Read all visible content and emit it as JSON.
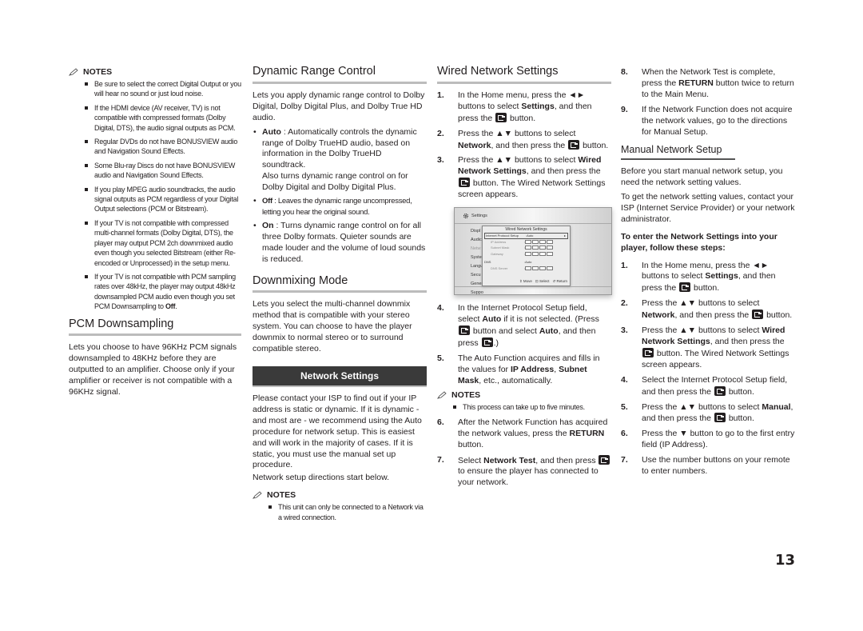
{
  "page_number": "13",
  "col1": {
    "notes_label": "NOTES",
    "notes": [
      "Be sure to select the correct Digital Output or you will hear no sound or just loud noise.",
      "If the HDMI device (AV receiver, TV) is not compatible with compressed formats (Dolby Digital, DTS), the audio signal outputs as PCM.",
      "Regular DVDs do not have BONUSVIEW audio and Navigation Sound Effects.",
      "Some Blu-ray Discs do not have BONUSVIEW audio and Navigation Sound Effects.",
      "If you play MPEG audio soundtracks, the audio signal outputs as PCM regardless of your Digital Output selections (PCM or Bitstream).",
      "If your TV is not compatible with compressed multi-channel formats (Dolby Digital, DTS), the player may output PCM 2ch downmixed audio even though you selected Bitstream (either Re-encoded or Unprocessed) in the setup menu."
    ],
    "note_last_prefix": "If your TV is not compatible with PCM sampling rates over 48kHz, the player may output 48kHz downsampled PCM audio even though you set PCM Downsampling to ",
    "note_last_bold": "Off",
    "note_last_suffix": ".",
    "pcm_title": "PCM Downsampling",
    "pcm_body": "Lets you choose to have 96KHz PCM signals downsampled to 48KHz before they are outputted to an amplifier. Choose only if your amplifier or receiver is not compatible with a 96KHz signal."
  },
  "col2": {
    "drc_title": "Dynamic Range Control",
    "drc_body": "Lets you apply dynamic range control to Dolby Digital, Dolby Digital Plus, and Dolby True HD audio.",
    "drc_options": [
      {
        "label": "Auto",
        "text": " : Automatically controls the dynamic range of Dolby TrueHD audio, based on information in the Dolby TrueHD soundtrack.",
        "extra": "Also turns dynamic range control on for Dolby Digital and Dolby Digital Plus."
      },
      {
        "label": "Off",
        "text": " : Leaves the dynamic range uncompressed, letting you hear the original sound."
      },
      {
        "label": "On",
        "text": " : Turns dynamic range control on for all three Dolby formats. Quieter sounds are made louder and the volume of loud sounds is reduced."
      }
    ],
    "downmix_title": "Downmixing Mode",
    "downmix_body": "Lets you select the multi-channel downmix method that is compatible with your stereo system. You can choose to have the player downmix to normal stereo or to surround compatible stereo.",
    "banner": "Network Settings",
    "network_body": "Please contact your ISP to find out if your IP address is static or dynamic. If it is dynamic - and most are - we recommend using the Auto procedure for network setup. This is easiest and will work in the majority of cases. If it is static, you must use the manual set up procedure.",
    "network_body2": "Network setup directions start below.",
    "notes_label": "NOTES",
    "notes": [
      "This unit can only be connected to a Network via a wired connection."
    ]
  },
  "col3": {
    "title": "Wired Network Settings",
    "steps": {
      "s1": {
        "num": "1.",
        "a": "In the Home menu, press the ◄► buttons to select ",
        "b": "Settings",
        "c": ", and then press the ",
        "d": " button."
      },
      "s2": {
        "num": "2.",
        "a": "Press the ▲▼ buttons to select ",
        "b": "Network",
        "c": ", and then press the ",
        "d": " button."
      },
      "s3": {
        "num": "3.",
        "a": "Press the ▲▼ buttons to select ",
        "b": "Wired Network Settings",
        "c": ", and then press the ",
        "d": " button. The Wired Network Settings screen appears."
      },
      "s4": {
        "num": "4.",
        "a": "In the Internet Protocol Setup field, select ",
        "b": "Auto",
        "c": " if it is not selected. (Press ",
        "d": " button and select ",
        "e": "Auto",
        "f": ", and then press ",
        "g": ".)"
      },
      "s5": {
        "num": "5.",
        "a": "The Auto Function acquires and fills in the values for ",
        "b": "IP Address",
        "c": ", ",
        "d": "Subnet Mask",
        "e": ", etc., automatically."
      },
      "s6": {
        "num": "6.",
        "a": "After the Network Function has acquired the network values, press the ",
        "b": "RETURN",
        "c": " button."
      },
      "s7": {
        "num": "7.",
        "a": "Select ",
        "b": "Network Test",
        "c": ", and then press ",
        "d": " to ensure the player has connected to your network."
      }
    },
    "notes_label": "NOTES",
    "notes": [
      "This process can take up to five minutes."
    ],
    "screen": {
      "header": "Settings",
      "menu": [
        "Displ",
        "Audic",
        "Netw",
        "Syste",
        "Langu",
        "Secu",
        "Gener",
        "Suppo"
      ],
      "dialog_title": "Wired Network Settings",
      "rows": [
        {
          "label": "Internet Protocol Setup",
          "value": "Auto"
        },
        {
          "label": "IP Address",
          "value": ""
        },
        {
          "label": "Subnet Mask",
          "value": ""
        },
        {
          "label": "Gateway",
          "value": ""
        },
        {
          "label": "DNS",
          "value": "Auto"
        },
        {
          "label": "DNS Server",
          "value": ""
        }
      ],
      "footer_move": "Move",
      "footer_select": "Select",
      "footer_return": "Return"
    }
  },
  "col4": {
    "s8": {
      "num": "8.",
      "a": "When the Network Test is complete, press the ",
      "b": "RETURN",
      "c": " button twice to return to the Main Menu."
    },
    "s9": {
      "num": "9.",
      "a": "If the Network Function does not acquire the network values, go to the directions for Manual Setup."
    },
    "manual_title": "Manual Network Setup",
    "manual_body1": "Before you start manual network setup, you need the network setting values.",
    "manual_body2": "To get the network setting values, contact your ISP (Internet Service Provider) or your network administrator.",
    "steps_intro": "To enter the Network Settings into your player, follow these steps:",
    "m1": {
      "num": "1.",
      "a": "In the Home menu, press the ◄► buttons to select ",
      "b": "Settings",
      "c": ", and then press the ",
      "d": " button."
    },
    "m2": {
      "num": "2.",
      "a": "Press the ▲▼ buttons to select ",
      "b": "Network",
      "c": ", and then press the ",
      "d": " button."
    },
    "m3": {
      "num": "3.",
      "a": "Press the ▲▼ buttons to select ",
      "b": "Wired Network Settings",
      "c": ", and then press the ",
      "d": " button. The Wired Network Settings screen appears."
    },
    "m4": {
      "num": "4.",
      "a": "Select the Internet Protocol Setup field, and then press the ",
      "d": " button."
    },
    "m5": {
      "num": "5.",
      "a": "Press the ▲▼ buttons to select ",
      "b": "Manual",
      "c": ", and then press the ",
      "d": " button."
    },
    "m6": {
      "num": "6.",
      "a": "Press the ▼ button to go to the first entry field (IP Address)."
    },
    "m7": {
      "num": "7.",
      "a": "Use the number buttons on your remote to enter numbers."
    }
  }
}
